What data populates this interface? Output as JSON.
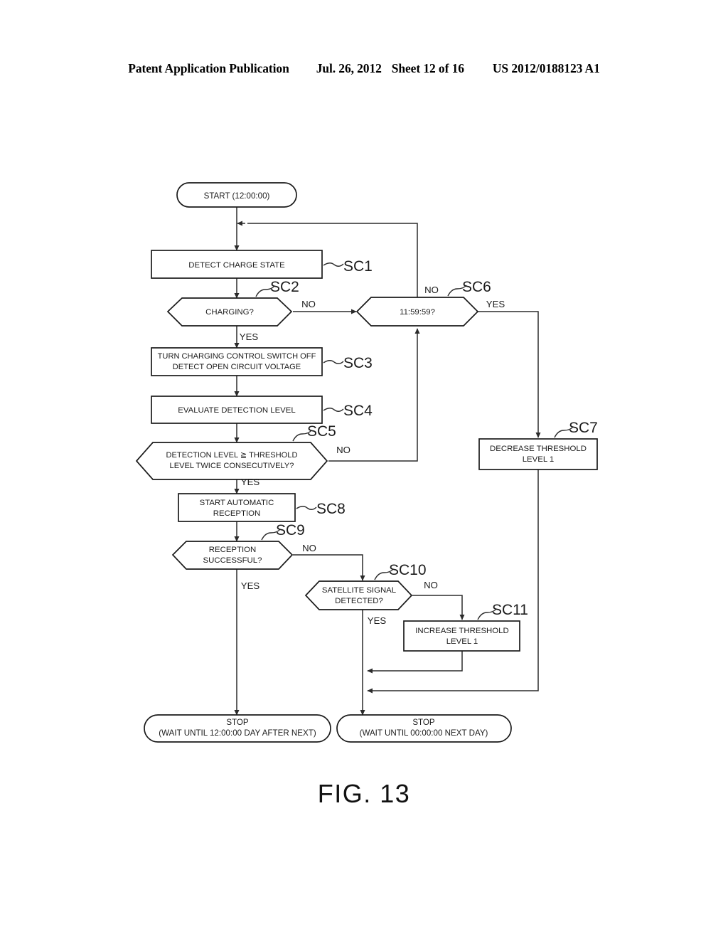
{
  "header": {
    "publication": "Patent Application Publication",
    "date": "Jul. 26, 2012",
    "sheet": "Sheet 12 of 16",
    "docnum": "US 2012/0188123 A1"
  },
  "figure": {
    "caption": "FIG. 13"
  },
  "flowchart": {
    "start": {
      "ref": "",
      "line1": "START (12:00:00)"
    },
    "stop_left": {
      "line1": "STOP",
      "line2": "(WAIT UNTIL 12:00:00 DAY AFTER NEXT)"
    },
    "stop_right": {
      "line1": "STOP",
      "line2": "(WAIT UNTIL 00:00:00 NEXT DAY)"
    },
    "steps": [
      {
        "ref": "SC1",
        "type": "process",
        "line1": "DETECT CHARGE STATE",
        "line2": ""
      },
      {
        "ref": "SC2",
        "type": "decision",
        "line1": "CHARGING?",
        "line2": ""
      },
      {
        "ref": "SC3",
        "type": "process",
        "line1": "TURN CHARGING CONTROL SWITCH OFF",
        "line2": "DETECT OPEN CIRCUIT VOLTAGE"
      },
      {
        "ref": "SC4",
        "type": "process",
        "line1": "EVALUATE DETECTION LEVEL",
        "line2": ""
      },
      {
        "ref": "SC5",
        "type": "decision",
        "line1": "DETECTION LEVEL ≧ THRESHOLD",
        "line2": "LEVEL TWICE CONSECUTIVELY?"
      },
      {
        "ref": "SC6",
        "type": "decision",
        "line1": "11:59:59?",
        "line2": ""
      },
      {
        "ref": "SC7",
        "type": "process",
        "line1": "DECREASE THRESHOLD",
        "line2": "LEVEL 1"
      },
      {
        "ref": "SC8",
        "type": "process",
        "line1": "START AUTOMATIC",
        "line2": "RECEPTION"
      },
      {
        "ref": "SC9",
        "type": "decision",
        "line1": "RECEPTION",
        "line2": "SUCCESSFUL?"
      },
      {
        "ref": "SC10",
        "type": "decision",
        "line1": "SATELLITE SIGNAL",
        "line2": "DETECTED?"
      },
      {
        "ref": "SC11",
        "type": "process",
        "line1": "INCREASE THRESHOLD",
        "line2": "LEVEL 1"
      }
    ],
    "edge_labels": {
      "sc2_no": "NO",
      "sc2_yes": "YES",
      "sc5_no": "NO",
      "sc5_yes": "YES",
      "sc6_no": "NO",
      "sc6_yes": "YES",
      "sc9_no": "NO",
      "sc9_yes": "YES",
      "sc10_no": "NO",
      "sc10_yes": "YES"
    }
  }
}
